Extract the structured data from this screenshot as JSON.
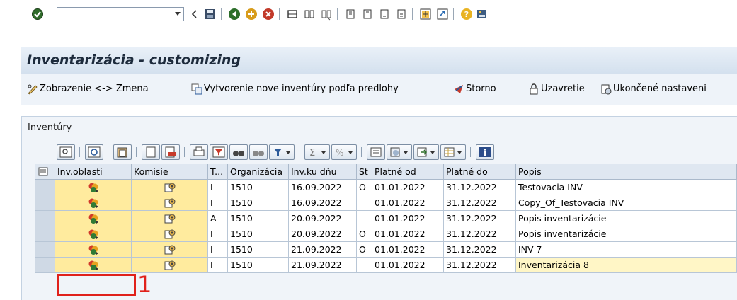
{
  "command_field": {
    "value": "",
    "placeholder": ""
  },
  "system_toolbar_icons": [
    "enter-icon",
    "back-icon",
    "save-icon",
    "exit-icon",
    "cancel-icon",
    "stop-icon",
    "print-icon",
    "find-icon",
    "find-next-icon",
    "first-page-icon",
    "prev-page-icon",
    "next-page-icon",
    "last-page-icon",
    "new-session-icon",
    "shortcut-icon",
    "help-icon",
    "layout-icon"
  ],
  "title": "Inventarizácia - customizing",
  "app_toolbar": {
    "toggle_label": "Zobrazenie <-> Zmena",
    "create_label": "Vytvorenie nove inventúry podľa predlohy",
    "storno_label": "Storno",
    "close_label": "Uzavretie",
    "finished_label": "Ukončené nastaveni"
  },
  "panel": {
    "title": "Inventúry"
  },
  "grid": {
    "columns": [
      "Inv.oblasti",
      "Komisie",
      "T...",
      "Organizácia",
      "Inv.ku dňu",
      "St",
      "Platné od",
      "Platné do",
      "Popis"
    ],
    "rows": [
      {
        "t": "I",
        "org": "1510",
        "date": "16.09.2022",
        "st": "O",
        "from": "01.01.2022",
        "to": "31.12.2022",
        "popis": "Testovacia INV"
      },
      {
        "t": "I",
        "org": "1510",
        "date": "16.09.2022",
        "st": "",
        "from": "01.01.2022",
        "to": "31.12.2022",
        "popis": "Copy_Of_Testovacia INV"
      },
      {
        "t": "A",
        "org": "1510",
        "date": "20.09.2022",
        "st": "",
        "from": "01.01.2022",
        "to": "31.12.2022",
        "popis": "Popis inventarizácie"
      },
      {
        "t": "I",
        "org": "1510",
        "date": "20.09.2022",
        "st": "O",
        "from": "01.01.2022",
        "to": "31.12.2022",
        "popis": "Popis inventarizácie"
      },
      {
        "t": "I",
        "org": "1510",
        "date": "21.09.2022",
        "st": "O",
        "from": "01.01.2022",
        "to": "31.12.2022",
        "popis": "INV 7"
      },
      {
        "t": "I",
        "org": "1510",
        "date": "21.09.2022",
        "st": "",
        "from": "01.01.2022",
        "to": "31.12.2022",
        "popis": "Inventarizácia 8"
      }
    ]
  },
  "annotation": {
    "marker": "1",
    "color": "#e0211b"
  },
  "colors": {
    "accent": "#ffeb9e",
    "highlight": "#fff6c6",
    "header": "#dfe7f1"
  }
}
